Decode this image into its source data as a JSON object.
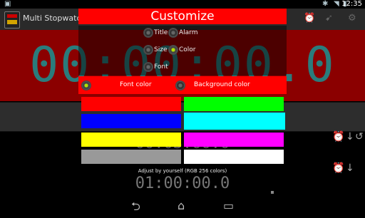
{
  "status_bar": {
    "time": "12:35",
    "icons": [
      "notification-icon",
      "bluetooth-icon",
      "wifi-icon",
      "battery-icon"
    ]
  },
  "action_bar": {
    "title": "Multi Stopwatch an",
    "icons": [
      "alarm-icon",
      "share-icon",
      "settings-icon"
    ]
  },
  "background": {
    "main_time": "00:00:00.0",
    "row2_time": "00:03:00.0",
    "row3_time": "01:00:00.0"
  },
  "dialog": {
    "title": "Customize",
    "options": [
      {
        "label": "Title",
        "selected": false
      },
      {
        "label": "Alarm",
        "selected": false
      },
      {
        "label": "Size",
        "selected": false
      },
      {
        "label": "Color",
        "selected": true
      },
      {
        "label": "Font",
        "selected": false
      }
    ],
    "tabs": [
      {
        "label": "Font color",
        "selected": true
      },
      {
        "label": "Background color",
        "selected": false
      }
    ],
    "swatches": [
      "#ff0000",
      "#00ff00",
      "#0000ff",
      "#00ffff",
      "#ffff00",
      "#ff00ff",
      "#999999",
      "#ffffff"
    ],
    "adjust_label": "Adjust by yourself (RGB 256 colors)"
  },
  "nav_bar": {
    "icons": [
      "back-icon",
      "home-icon",
      "recent-apps-icon"
    ]
  }
}
